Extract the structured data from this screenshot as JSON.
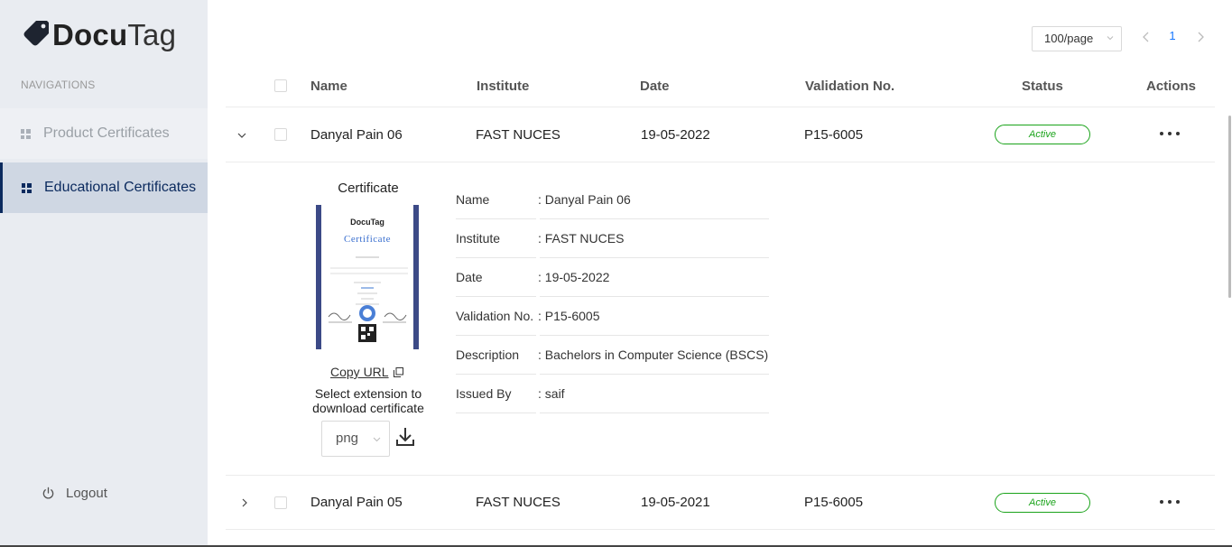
{
  "brand": {
    "name_bold": "Docu",
    "name_light": "Tag"
  },
  "sidebar": {
    "heading": "NAVIGATIONS",
    "items": [
      {
        "label": "Product Certificates",
        "active": false
      },
      {
        "label": "Educational Certificates",
        "active": true
      }
    ],
    "logout": "Logout"
  },
  "pagination": {
    "page_size": "100/page",
    "current_page": "1"
  },
  "table": {
    "columns": [
      "Name",
      "Institute",
      "Date",
      "Validation No.",
      "Status",
      "Actions"
    ],
    "rows": [
      {
        "name": "Danyal Pain 06",
        "institute": "FAST NUCES",
        "date": "19-05-2022",
        "validation_no": "P15-6005",
        "status": "Active",
        "expanded": true
      },
      {
        "name": "Danyal Pain 05",
        "institute": "FAST NUCES",
        "date": "19-05-2021",
        "validation_no": "P15-6005",
        "status": "Active",
        "expanded": false
      }
    ]
  },
  "expanded": {
    "certificate_title": "Certificate",
    "thumbnail": {
      "brand": "DocuTag",
      "heading": "Certificate"
    },
    "copy_url": "Copy URL",
    "select_extension": "Select extension to download certificate",
    "extension": "png",
    "details": [
      {
        "label": "Name",
        "value": ": Danyal Pain 06"
      },
      {
        "label": "Institute",
        "value": ": FAST NUCES"
      },
      {
        "label": "Date",
        "value": ": 19-05-2022"
      },
      {
        "label": "Validation No.",
        "value": ": P15-6005"
      },
      {
        "label": "Description",
        "value": ": Bachelors in Computer Science (BSCS)"
      },
      {
        "label": "Issued By",
        "value": ": saif"
      }
    ]
  },
  "colors": {
    "sidebar_bg": "#e9ecf1",
    "active_nav": "#0b2a5e",
    "status_green": "#1aa31a",
    "accent_blue": "#1677ff"
  }
}
